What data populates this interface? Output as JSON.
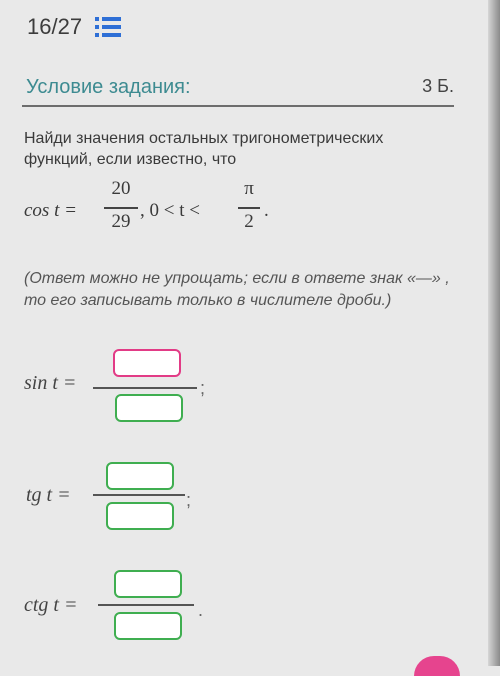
{
  "header": {
    "counter": "16/27"
  },
  "section": {
    "title": "Условие задания:",
    "points": "3 Б."
  },
  "task": {
    "text": "Найди значения остальных тригонометрических функций, если известно, что"
  },
  "condition": {
    "lhs": "cos t =",
    "num": "20",
    "den": "29",
    "ineq": ", 0 < t <",
    "pi": "π",
    "two": "2",
    "end": "."
  },
  "note": {
    "text": "(Ответ можно не упрощать; если в ответе знак «—» , то его записывать только в числителе дроби.)"
  },
  "answers": [
    {
      "label": "sin t =",
      "end": ";"
    },
    {
      "label": "tg t =",
      "end": ";"
    },
    {
      "label": "ctg t =",
      "end": "."
    }
  ],
  "colors": {
    "accent": "#3d8b91",
    "focus_border": "#e23b86",
    "box_border": "#3fae50"
  },
  "icons": {
    "list": "list-icon"
  }
}
